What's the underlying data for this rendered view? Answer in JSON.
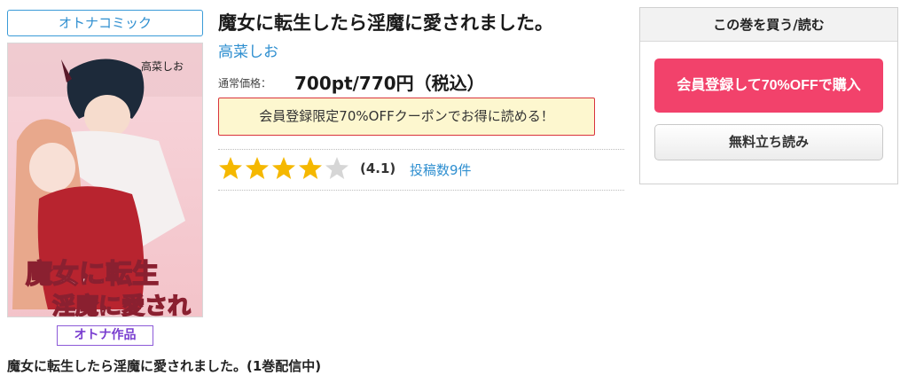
{
  "category": {
    "label": "オトナコミック"
  },
  "cover": {
    "title_art": "魔女に転生したら淫魔に愛されました。",
    "author_art": "高菜しお"
  },
  "adult_badge": {
    "label": "オトナ作品"
  },
  "series_caption": "魔女に転生したら淫魔に愛されました。(1巻配信中)",
  "book": {
    "title": "魔女に転生したら淫魔に愛されました。",
    "author": "高菜しお",
    "price_label": "通常価格：",
    "price": "700pt/770円（税込）",
    "coupon_text": "会員登録限定70%OFFクーポンでお得に読める！",
    "rating": {
      "stars": 4,
      "max": 5,
      "score_text": "(4.1)",
      "reviews_text": "投稿数9件"
    }
  },
  "buy_panel": {
    "header": "この巻を買う/読む",
    "register_button": "会員登録して70%OFFで購入",
    "preview_button": "無料立ち読み"
  },
  "colors": {
    "accent_blue": "#2f8fd0",
    "buy_pink": "#f2426b",
    "coupon_bg": "#fdf7cf",
    "coupon_border": "#d9333c",
    "star_on": "#f5b800",
    "star_off": "#d6d6d6",
    "adult_purple": "#7a3fd0"
  }
}
